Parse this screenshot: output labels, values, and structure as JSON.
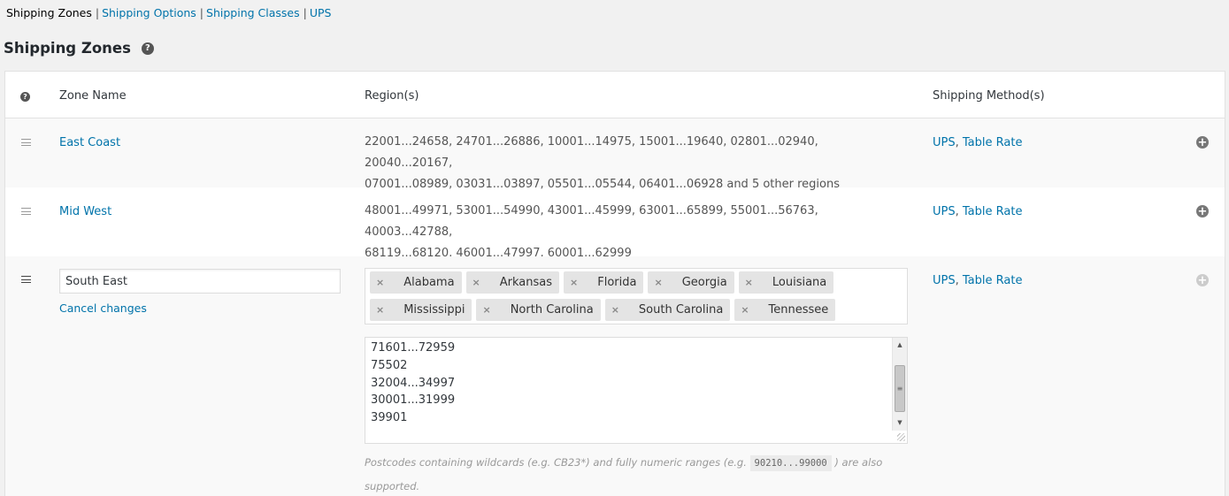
{
  "subnav": {
    "items": [
      {
        "label": "Shipping Zones",
        "current": true
      },
      {
        "label": "Shipping Options",
        "current": false
      },
      {
        "label": "Shipping Classes",
        "current": false
      },
      {
        "label": "UPS",
        "current": false
      }
    ],
    "separator": "|"
  },
  "page": {
    "title": "Shipping Zones",
    "help_glyph": "?"
  },
  "table": {
    "headers": {
      "help": "?",
      "zone_name": "Zone Name",
      "regions": "Region(s)",
      "methods": "Shipping Method(s)"
    },
    "rows": [
      {
        "name": "East Coast",
        "regions_line1": "22001...24658, 24701...26886, 10001...14975, 15001...19640, 02801...02940, 20040...20167,",
        "regions_line2": "07001...08989, 03031...03897, 05501...05544, 06401...06928 and 5 other regions",
        "method1": "UPS",
        "method_sep": ",",
        "method2": "Table Rate"
      },
      {
        "name": "Mid West",
        "regions_line1": "48001...49971, 53001...54990, 43001...45999, 63001...65899, 55001...56763, 40003...42788,",
        "regions_line2": "68119...68120, 46001...47997, 60001...62999",
        "method1": "UPS",
        "method_sep": ",",
        "method2": "Table Rate"
      }
    ],
    "editing": {
      "name_value": "South East",
      "cancel_label": "Cancel changes",
      "chips": [
        "Alabama",
        "Arkansas",
        "Florida",
        "Georgia",
        "Louisiana",
        "Mississippi",
        "North Carolina",
        "South Carolina",
        "Tennessee"
      ],
      "chip_remove_glyph": "×",
      "postcodes": [
        "71601...72959",
        "75502",
        "32004...34997",
        "30001...31999",
        "39901"
      ],
      "hint_before": "Postcodes containing wildcards (e.g. CB23*) and fully numeric ranges (e.g. ",
      "hint_code": "90210...99000",
      "hint_after": " ) are also supported.",
      "method1": "UPS",
      "method_sep": ",",
      "method2": "Table Rate"
    },
    "add_glyph": "+"
  },
  "colors": {
    "link": "#0073aa",
    "background": "#f1f1f1",
    "table_bg": "#ffffff",
    "alt_row": "#f9f9f9"
  }
}
